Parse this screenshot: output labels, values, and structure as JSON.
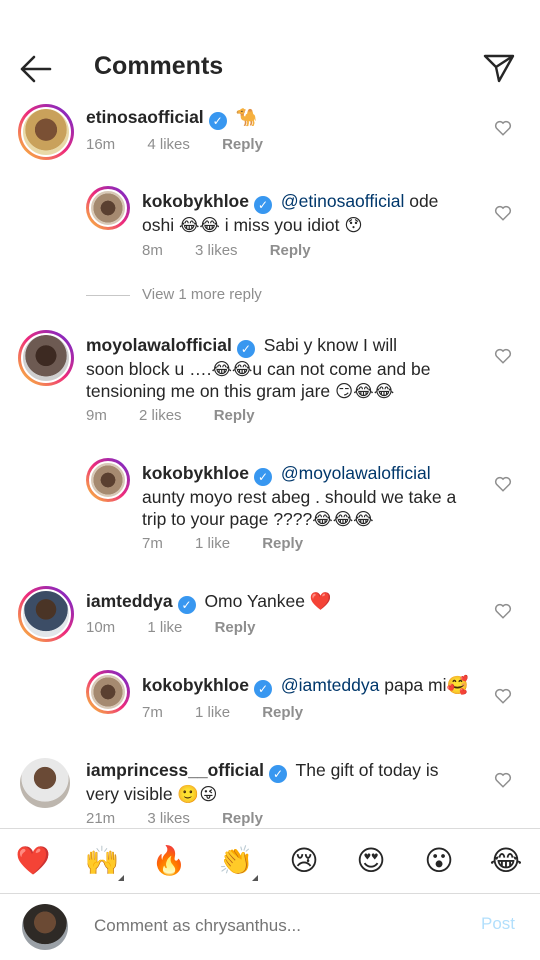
{
  "header": {
    "title": "Comments",
    "back_icon": "arrow-left-icon",
    "send_icon": "paper-plane-icon"
  },
  "comments": [
    {
      "username": "etinosaofficial",
      "text": "🐪",
      "time": "16m",
      "likes": "4 likes",
      "reply": "Reply"
    },
    {
      "username": "kokobykhloe",
      "mention": "@etinosaofficial",
      "text_after_mention": " ode",
      "text_line2": "oshi 😂😂 i miss you idiot 😯",
      "time": "8m",
      "likes": "3 likes",
      "reply": "Reply"
    },
    {
      "username": "moyolawalofficial",
      "text": "Sabi y know I will",
      "text_line2": "soon block u ….😂😂u can not come and be",
      "text_line3": "tensioning me on this gram jare 😏😂😂",
      "time": "9m",
      "likes": "2 likes",
      "reply": "Reply"
    },
    {
      "username": "kokobykhloe",
      "mention": "@moyolawalofficial",
      "text_line2": "aunty moyo rest abeg . should we take a",
      "text_line3": "trip to your page ????😂😂😂",
      "time": "7m",
      "likes": "1 like",
      "reply": "Reply"
    },
    {
      "username": "iamteddya",
      "text": "Omo Yankee ❤️",
      "time": "10m",
      "likes": "1 like",
      "reply": "Reply"
    },
    {
      "username": "kokobykhloe",
      "mention": "@iamteddya",
      "text_after_mention": " papa mi🥰",
      "time": "7m",
      "likes": "1 like",
      "reply": "Reply"
    },
    {
      "username": "iamprincess__official",
      "text": "The gift of today is",
      "text_line2": "very visible 🙂😜",
      "time": "21m",
      "likes": "3 likes",
      "reply": "Reply"
    }
  ],
  "view_more": "View 1 more reply",
  "emoji_bar": {
    "items": [
      "❤️",
      "🙌",
      "🔥",
      "👏",
      "😢",
      "😍",
      "😮",
      "😂"
    ]
  },
  "composer": {
    "placeholder": "Comment as chrysanthus...",
    "post_label": "Post"
  },
  "colors": {
    "verified": "#3897f0",
    "mention": "#00376b",
    "post_disabled": "#b2dffc"
  }
}
